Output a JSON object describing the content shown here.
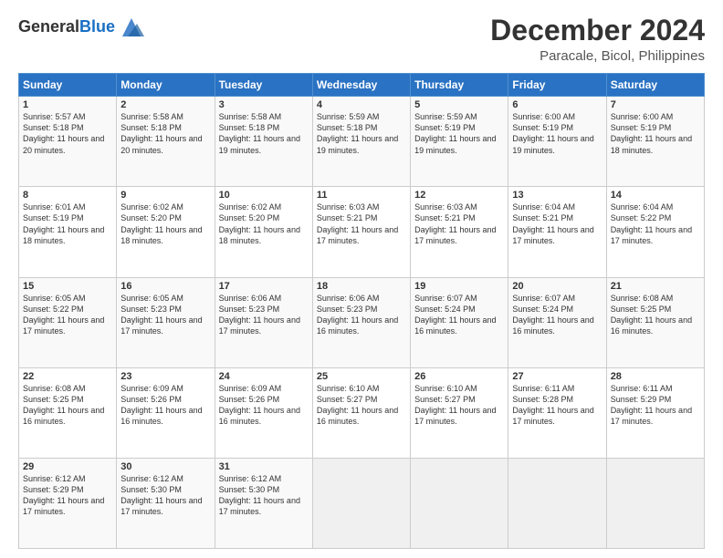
{
  "header": {
    "logo_general": "General",
    "logo_blue": "Blue",
    "month": "December 2024",
    "location": "Paracale, Bicol, Philippines"
  },
  "calendar": {
    "days_of_week": [
      "Sunday",
      "Monday",
      "Tuesday",
      "Wednesday",
      "Thursday",
      "Friday",
      "Saturday"
    ],
    "weeks": [
      [
        {
          "day": "",
          "info": ""
        },
        {
          "day": "2",
          "info": "Sunrise: 5:58 AM\nSunset: 5:18 PM\nDaylight: 11 hours\nand 20 minutes."
        },
        {
          "day": "3",
          "info": "Sunrise: 5:58 AM\nSunset: 5:18 PM\nDaylight: 11 hours\nand 19 minutes."
        },
        {
          "day": "4",
          "info": "Sunrise: 5:59 AM\nSunset: 5:18 PM\nDaylight: 11 hours\nand 19 minutes."
        },
        {
          "day": "5",
          "info": "Sunrise: 5:59 AM\nSunset: 5:19 PM\nDaylight: 11 hours\nand 19 minutes."
        },
        {
          "day": "6",
          "info": "Sunrise: 6:00 AM\nSunset: 5:19 PM\nDaylight: 11 hours\nand 19 minutes."
        },
        {
          "day": "7",
          "info": "Sunrise: 6:00 AM\nSunset: 5:19 PM\nDaylight: 11 hours\nand 18 minutes."
        }
      ],
      [
        {
          "day": "8",
          "info": "Sunrise: 6:01 AM\nSunset: 5:19 PM\nDaylight: 11 hours\nand 18 minutes."
        },
        {
          "day": "9",
          "info": "Sunrise: 6:02 AM\nSunset: 5:20 PM\nDaylight: 11 hours\nand 18 minutes."
        },
        {
          "day": "10",
          "info": "Sunrise: 6:02 AM\nSunset: 5:20 PM\nDaylight: 11 hours\nand 18 minutes."
        },
        {
          "day": "11",
          "info": "Sunrise: 6:03 AM\nSunset: 5:21 PM\nDaylight: 11 hours\nand 17 minutes."
        },
        {
          "day": "12",
          "info": "Sunrise: 6:03 AM\nSunset: 5:21 PM\nDaylight: 11 hours\nand 17 minutes."
        },
        {
          "day": "13",
          "info": "Sunrise: 6:04 AM\nSunset: 5:21 PM\nDaylight: 11 hours\nand 17 minutes."
        },
        {
          "day": "14",
          "info": "Sunrise: 6:04 AM\nSunset: 5:22 PM\nDaylight: 11 hours\nand 17 minutes."
        }
      ],
      [
        {
          "day": "15",
          "info": "Sunrise: 6:05 AM\nSunset: 5:22 PM\nDaylight: 11 hours\nand 17 minutes."
        },
        {
          "day": "16",
          "info": "Sunrise: 6:05 AM\nSunset: 5:23 PM\nDaylight: 11 hours\nand 17 minutes."
        },
        {
          "day": "17",
          "info": "Sunrise: 6:06 AM\nSunset: 5:23 PM\nDaylight: 11 hours\nand 17 minutes."
        },
        {
          "day": "18",
          "info": "Sunrise: 6:06 AM\nSunset: 5:23 PM\nDaylight: 11 hours\nand 16 minutes."
        },
        {
          "day": "19",
          "info": "Sunrise: 6:07 AM\nSunset: 5:24 PM\nDaylight: 11 hours\nand 16 minutes."
        },
        {
          "day": "20",
          "info": "Sunrise: 6:07 AM\nSunset: 5:24 PM\nDaylight: 11 hours\nand 16 minutes."
        },
        {
          "day": "21",
          "info": "Sunrise: 6:08 AM\nSunset: 5:25 PM\nDaylight: 11 hours\nand 16 minutes."
        }
      ],
      [
        {
          "day": "22",
          "info": "Sunrise: 6:08 AM\nSunset: 5:25 PM\nDaylight: 11 hours\nand 16 minutes."
        },
        {
          "day": "23",
          "info": "Sunrise: 6:09 AM\nSunset: 5:26 PM\nDaylight: 11 hours\nand 16 minutes."
        },
        {
          "day": "24",
          "info": "Sunrise: 6:09 AM\nSunset: 5:26 PM\nDaylight: 11 hours\nand 16 minutes."
        },
        {
          "day": "25",
          "info": "Sunrise: 6:10 AM\nSunset: 5:27 PM\nDaylight: 11 hours\nand 16 minutes."
        },
        {
          "day": "26",
          "info": "Sunrise: 6:10 AM\nSunset: 5:27 PM\nDaylight: 11 hours\nand 17 minutes."
        },
        {
          "day": "27",
          "info": "Sunrise: 6:11 AM\nSunset: 5:28 PM\nDaylight: 11 hours\nand 17 minutes."
        },
        {
          "day": "28",
          "info": "Sunrise: 6:11 AM\nSunset: 5:29 PM\nDaylight: 11 hours\nand 17 minutes."
        }
      ],
      [
        {
          "day": "29",
          "info": "Sunrise: 6:12 AM\nSunset: 5:29 PM\nDaylight: 11 hours\nand 17 minutes."
        },
        {
          "day": "30",
          "info": "Sunrise: 6:12 AM\nSunset: 5:30 PM\nDaylight: 11 hours\nand 17 minutes."
        },
        {
          "day": "31",
          "info": "Sunrise: 6:12 AM\nSunset: 5:30 PM\nDaylight: 11 hours\nand 17 minutes."
        },
        {
          "day": "",
          "info": ""
        },
        {
          "day": "",
          "info": ""
        },
        {
          "day": "",
          "info": ""
        },
        {
          "day": "",
          "info": ""
        }
      ]
    ],
    "week1_sunday": {
      "day": "1",
      "info": "Sunrise: 5:57 AM\nSunset: 5:18 PM\nDaylight: 11 hours\nand 20 minutes."
    }
  }
}
